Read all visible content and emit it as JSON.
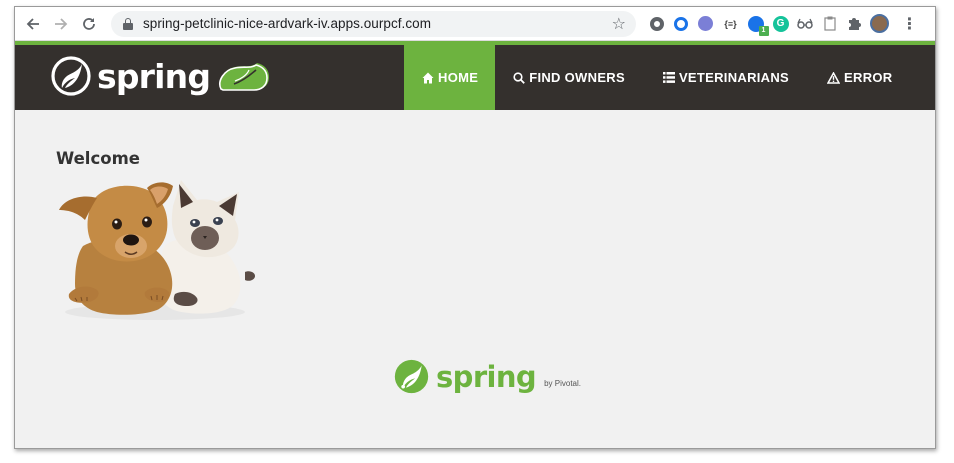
{
  "browser": {
    "url": "spring-petclinic-nice-ardvark-iv.apps.ourpcf.com",
    "extensions": [
      "circle-extension-icon",
      "refresh-blue-extension-icon",
      "purple-extension-icon",
      "json-extension-icon",
      "blue-badge-extension-icon",
      "grammarly-extension-icon",
      "glasses-extension-icon",
      "clipboard-extension-icon",
      "puzzle-extensions-icon",
      "profile-avatar"
    ],
    "ext_json_label": "{≡}",
    "ext_grammarly_label": "G",
    "ext_badge_count": "1"
  },
  "brand": {
    "logo_text": "spring",
    "accent_color": "#6db33f",
    "navbar_color": "#34302d"
  },
  "nav": {
    "items": [
      {
        "label": "HOME",
        "icon": "home-icon",
        "active": true
      },
      {
        "label": "FIND OWNERS",
        "icon": "search-icon",
        "active": false
      },
      {
        "label": "VETERINARIANS",
        "icon": "list-icon",
        "active": false
      },
      {
        "label": "ERROR",
        "icon": "warning-icon",
        "active": false
      }
    ]
  },
  "main": {
    "heading": "Welcome",
    "image": "puppy-and-kitten"
  },
  "footer": {
    "logo_text": "spring",
    "by_text": "by Pivotal."
  }
}
